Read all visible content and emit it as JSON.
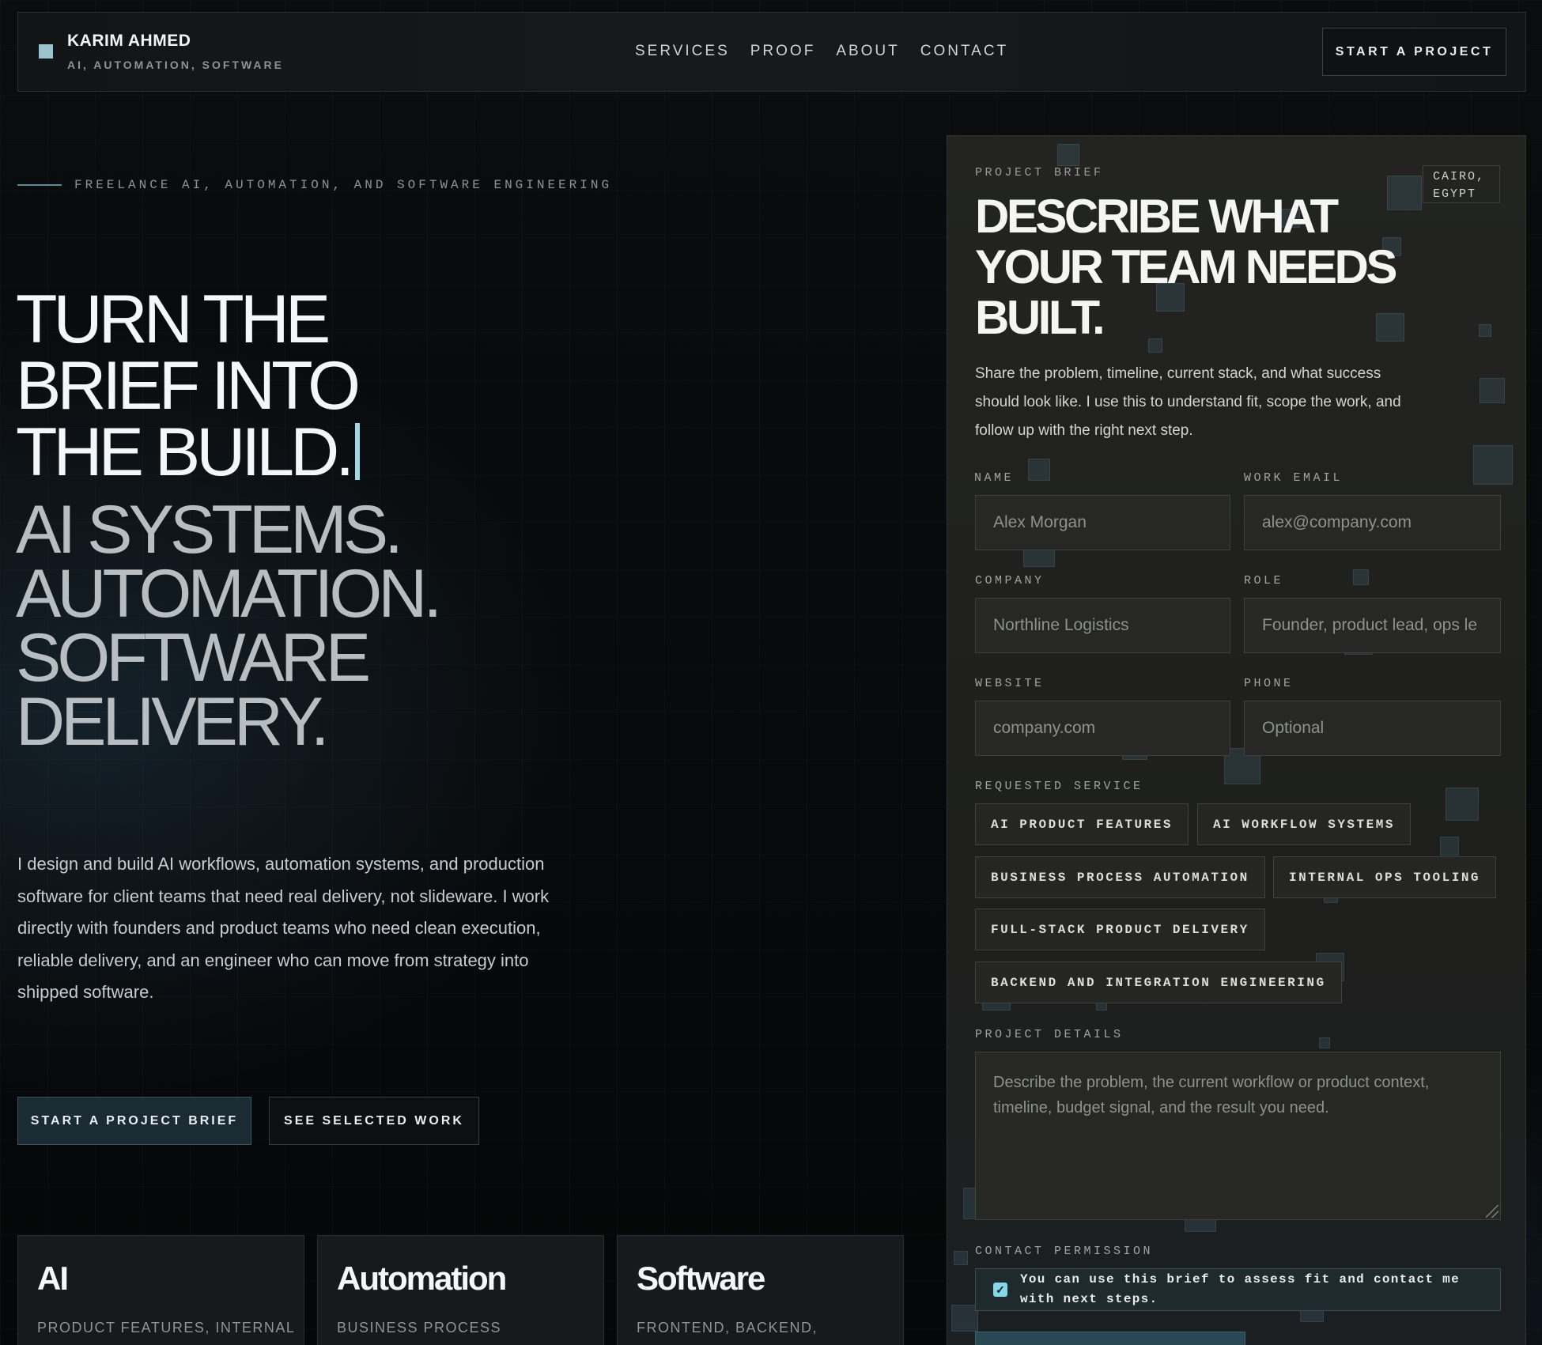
{
  "header": {
    "brand_name": "KARIM AHMED",
    "brand_tagline": "AI, AUTOMATION, SOFTWARE",
    "nav": [
      {
        "label": "SERVICES"
      },
      {
        "label": "PROOF"
      },
      {
        "label": "ABOUT"
      },
      {
        "label": "CONTACT"
      }
    ],
    "cta_label": "START A PROJECT"
  },
  "hero": {
    "eyebrow": "FREELANCE AI, AUTOMATION, AND SOFTWARE ENGINEERING",
    "headline_lines": [
      "TURN THE",
      "BRIEF INTO",
      "THE BUILD."
    ],
    "subheadline_lines": [
      "AI SYSTEMS.",
      "AUTOMATION.",
      "SOFTWARE",
      "DELIVERY."
    ],
    "description": "I design and build AI workflows, automation systems, and production software for client teams that need real delivery, not slideware. I work directly with founders and product teams who need clean execution, reliable delivery, and an engineer who can move from strategy into shipped software.",
    "primary_button": "START A PROJECT BRIEF",
    "secondary_button": "SEE SELECTED WORK"
  },
  "cards": [
    {
      "title": "AI",
      "subtitle": "PRODUCT FEATURES, INTERNAL"
    },
    {
      "title": "Automation",
      "subtitle": "BUSINESS PROCESS"
    },
    {
      "title": "Software",
      "subtitle": "FRONTEND, BACKEND,"
    }
  ],
  "form": {
    "eyebrow": "PROJECT BRIEF",
    "location": "CAIRO, EGYPT",
    "title": "DESCRIBE WHAT YOUR TEAM NEEDS BUILT.",
    "description": "Share the problem, timeline, current stack, and what success should look like. I use this to understand fit, scope the work, and follow up with the right next step.",
    "fields": {
      "name": {
        "label": "NAME",
        "placeholder": "Alex Morgan"
      },
      "email": {
        "label": "WORK EMAIL",
        "placeholder": "alex@company.com"
      },
      "company": {
        "label": "COMPANY",
        "placeholder": "Northline Logistics"
      },
      "role": {
        "label": "ROLE",
        "placeholder": "Founder, product lead, ops le"
      },
      "website": {
        "label": "WEBSITE",
        "placeholder": "company.com"
      },
      "phone": {
        "label": "PHONE",
        "placeholder": "Optional"
      }
    },
    "service_label": "REQUESTED SERVICE",
    "services": [
      "AI PRODUCT FEATURES",
      "AI WORKFLOW SYSTEMS",
      "BUSINESS PROCESS AUTOMATION",
      "INTERNAL OPS TOOLING",
      "FULL-STACK PRODUCT DELIVERY",
      "BACKEND AND INTEGRATION ENGINEERING"
    ],
    "details_label": "PROJECT DETAILS",
    "details_placeholder": "Describe the problem, the current workflow or product context, timeline, budget signal, and the result you need.",
    "permission_label": "CONTACT PERMISSION",
    "permission_text": "You can use this brief to assess fit and contact me with next steps.",
    "permission_checked": true
  },
  "colors": {
    "accent": "#86d7e8",
    "background": "#07090b",
    "panel": "#20211e"
  }
}
